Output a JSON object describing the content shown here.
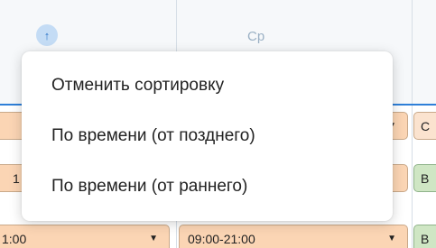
{
  "header": {
    "day_label": "Ср",
    "sort_icon": "arrow-up-icon"
  },
  "rows": [
    {
      "left_text": "",
      "mid_text": "",
      "side_text": "С",
      "side_color": "#fbe3cf"
    },
    {
      "left_text": "1",
      "mid_text": "",
      "side_text": "В",
      "side_color": "#cfe6c4"
    },
    {
      "left_text": "1:00",
      "mid_text": "09:00-21:00",
      "side_text": "В",
      "side_color": "#cfe6c4"
    }
  ],
  "menu": {
    "items": [
      {
        "label": "Отменить сортировку"
      },
      {
        "label": "По времени (от позднего)"
      },
      {
        "label": "По времени (от раннего)"
      }
    ]
  },
  "colors": {
    "accent": "#2e7fd8",
    "cell_bg": "#fbd5b4",
    "header_bg": "#f6f8fa"
  }
}
